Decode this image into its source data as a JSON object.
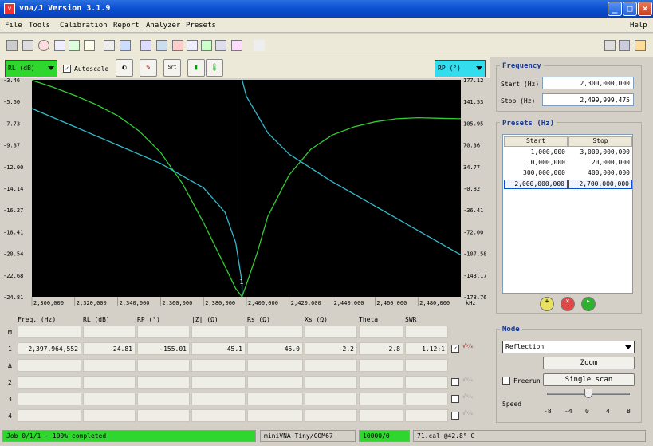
{
  "window": {
    "title": "vna/J Version 3.1.9"
  },
  "menu": {
    "file": "File",
    "tools": "Tools",
    "calibration": "Calibration",
    "report": "Report",
    "analyzer": "Analyzer",
    "presets": "Presets",
    "help": "Help"
  },
  "controls": {
    "left_trace": "RL (dB)",
    "right_trace": "RP (°)",
    "autoscale": "Autoscale"
  },
  "chart_data": {
    "type": "line",
    "x_ticks": [
      "2,300,000",
      "2,320,000",
      "2,340,000",
      "2,360,000",
      "2,380,000",
      "2,400,000",
      "2,420,000",
      "2,440,000",
      "2,460,000",
      "2,480,000"
    ],
    "x_unit": "kHz",
    "y_left_ticks": [
      "-3.46",
      "-5.60",
      "-7.73",
      "-9.87",
      "-12.00",
      "-14.14",
      "-16.27",
      "-18.41",
      "-20.54",
      "-22.68",
      "-24.81"
    ],
    "y_right_ticks": [
      "177.12",
      "141.53",
      "105.95",
      "70.36",
      "34.77",
      "-0.82",
      "-36.41",
      "-72.00",
      "-107.58",
      "-143.17",
      "-178.76"
    ],
    "ylim_left": [
      -24.81,
      -3.46
    ],
    "ylim_right": [
      -178.76,
      177.12
    ],
    "xlim": [
      2300000,
      2499999.475
    ],
    "marker_label": "1",
    "series": [
      {
        "axis": "left",
        "color": "#33cc33",
        "x": [
          2300000,
          2310000,
          2320000,
          2330000,
          2340000,
          2350000,
          2360000,
          2370000,
          2380000,
          2390000,
          2395000,
          2397964,
          2400000,
          2405000,
          2410000,
          2420000,
          2430000,
          2440000,
          2450000,
          2460000,
          2470000,
          2480000,
          2490000,
          2499999
        ],
        "y": [
          -3.5,
          -4.2,
          -5.0,
          -5.9,
          -7.0,
          -8.5,
          -10.6,
          -13.6,
          -17.5,
          -21.8,
          -24.0,
          -24.8,
          -23.6,
          -20.5,
          -16.9,
          -12.8,
          -10.3,
          -8.9,
          -8.1,
          -7.6,
          -7.3,
          -7.2,
          -7.25,
          -7.3
        ]
      },
      {
        "axis": "right",
        "color": "#33bbcc",
        "x": [
          2300000,
          2320000,
          2340000,
          2360000,
          2380000,
          2390000,
          2395000,
          2397964,
          2398000,
          2400000,
          2410000,
          2420000,
          2440000,
          2460000,
          2480000,
          2499999
        ],
        "y": [
          130,
          100,
          70,
          40,
          0,
          -40,
          -90,
          -155,
          177,
          150,
          90,
          55,
          10,
          -30,
          -70,
          -110
        ]
      }
    ]
  },
  "table": {
    "headers": [
      "Freq. (Hz)",
      "RL (dB)",
      "RP (°)",
      "|Z| (Ω)",
      "Rs (Ω)",
      "Xs (Ω)",
      "Theta",
      "SWR"
    ],
    "rows": [
      {
        "label": "M",
        "values": [
          "",
          "",
          "",
          "",
          "",
          "",
          "",
          ""
        ]
      },
      {
        "label": "1",
        "values": [
          "2,397,964,552",
          "-24.81",
          "-155.01",
          "45.1",
          "45.0",
          "-2.2",
          "-2.8",
          "1.12:1"
        ]
      },
      {
        "label": "Δ",
        "values": [
          "",
          "",
          "",
          "",
          "",
          "",
          "",
          ""
        ]
      },
      {
        "label": "2",
        "values": [
          "",
          "",
          "",
          "",
          "",
          "",
          "",
          ""
        ]
      },
      {
        "label": "3",
        "values": [
          "",
          "",
          "",
          "",
          "",
          "",
          "",
          ""
        ]
      },
      {
        "label": "4",
        "values": [
          "",
          "",
          "",
          "",
          "",
          "",
          "",
          ""
        ]
      }
    ]
  },
  "frequency": {
    "title": "Frequency",
    "start_label": "Start (Hz)",
    "start_value": "2,300,000,000",
    "stop_label": "Stop (Hz)",
    "stop_value": "2,499,999,475"
  },
  "presets": {
    "title": "Presets (Hz)",
    "headers": [
      "Start",
      "Stop"
    ],
    "rows": [
      [
        "1,000,000",
        "3,000,000,000"
      ],
      [
        "10,000,000",
        "20,000,000"
      ],
      [
        "300,000,000",
        "400,000,000"
      ],
      [
        "2,000,000,000",
        "2,700,000,000"
      ]
    ]
  },
  "mode": {
    "title": "Mode",
    "selected": "Reflection",
    "zoom": "Zoom",
    "freerun": "Freerun",
    "single_scan": "Single scan",
    "speed_label": "Speed",
    "speed_ticks": [
      "-8",
      "-4",
      "0",
      "4",
      "8"
    ],
    "speed_value": 0
  },
  "status": {
    "job": "Job 0/1/1 - 100% completed",
    "device": "miniVNA Tiny/COM67",
    "counter": "10000/0",
    "cal": "71.cal @42.8° C"
  },
  "colors": {
    "accent_green": "#2ed62e",
    "cyan": "#33ddee"
  }
}
